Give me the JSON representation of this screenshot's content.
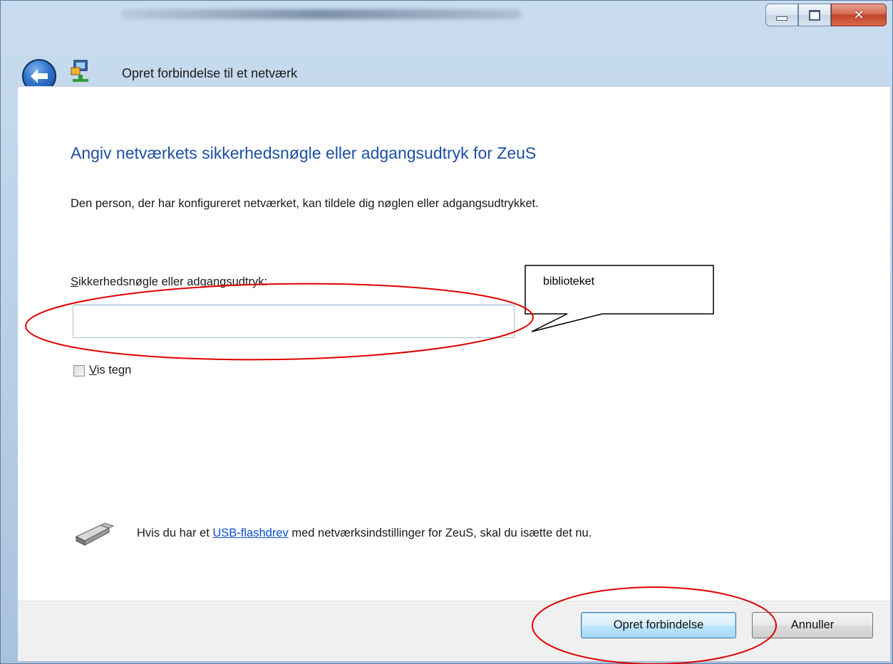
{
  "window": {
    "caption_buttons": {
      "minimize_icon": "minimize-icon",
      "maximize_icon": "maximize-icon",
      "close_icon": "close-icon"
    }
  },
  "nav": {
    "title": "Opret forbindelse til et netværk"
  },
  "main": {
    "heading": "Angiv netværkets sikkerhedsnøgle eller adgangsudtryk for ZeuS",
    "description": "Den person, der har konfigureret netværket, kan tildele dig nøglen eller adgangsudtrykket.",
    "field_label_first": "S",
    "field_label_rest": "ikkerhedsnøgle eller adgangsudtryk:",
    "key_input_value": "",
    "show_chars_first": "V",
    "show_chars_rest": "is tegn",
    "show_chars_checked": false,
    "usb_text_before": "Hvis du har et ",
    "usb_link": "USB-flashdrev",
    "usb_text_after": " med netværksindstillinger for ZeuS, skal du isætte det nu."
  },
  "footer": {
    "connect_label": "Opret forbindelse",
    "cancel_label": "Annuller"
  },
  "annotation": {
    "callout_text": "biblioteket",
    "highlight_color": "#e00000"
  },
  "colors": {
    "heading": "#1d4fa0",
    "link": "#0a4fc7",
    "frame": "#b7cde4"
  }
}
